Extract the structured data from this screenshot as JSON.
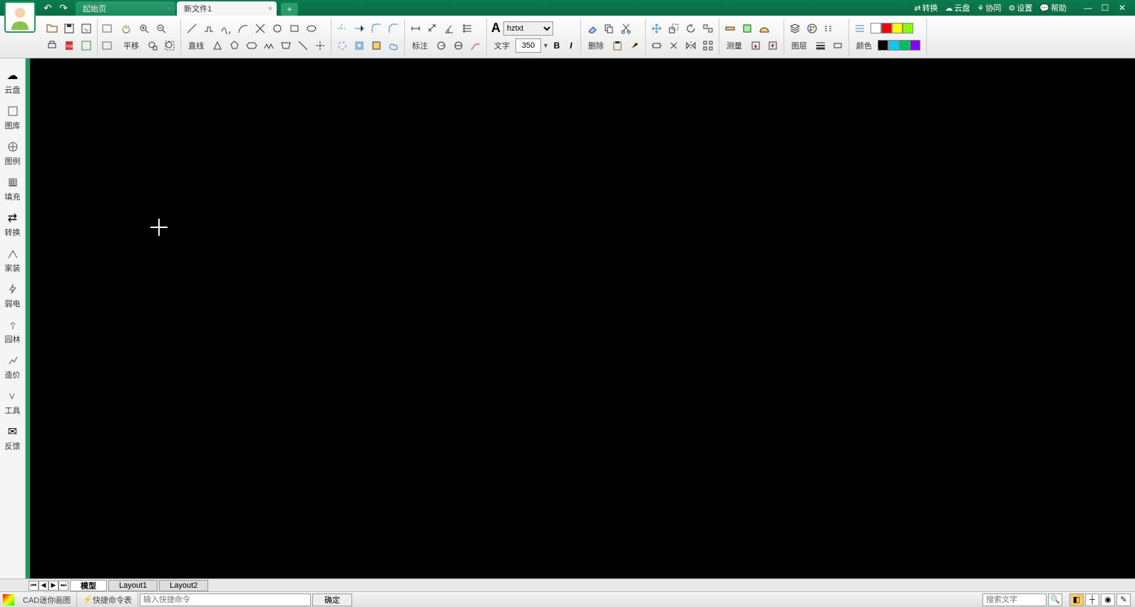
{
  "title_bar": {
    "tabs": [
      {
        "label": "起始页"
      },
      {
        "label": "新文件1"
      }
    ],
    "links": {
      "convert": "转换",
      "cloud": "云盘",
      "collab": "协同",
      "settings": "设置",
      "help": "帮助"
    }
  },
  "ribbon": {
    "pan": "平移",
    "line": "直线",
    "dim": "标注",
    "text": "文字",
    "font_name": "hztxt",
    "font_size": "350",
    "bold": "B",
    "italic": "I",
    "delete": "删除",
    "measure": "测量",
    "layer": "图层",
    "color": "颜色"
  },
  "sidebar": {
    "items": [
      {
        "label": "云盘"
      },
      {
        "label": "图库"
      },
      {
        "label": "图例"
      },
      {
        "label": "填充"
      },
      {
        "label": "转换"
      },
      {
        "label": "家装"
      },
      {
        "label": "弱电"
      },
      {
        "label": "园林"
      },
      {
        "label": "造价"
      },
      {
        "label": "工具"
      },
      {
        "label": "反馈"
      }
    ]
  },
  "layout_tabs": {
    "model": "模型",
    "layout1": "Layout1",
    "layout2": "Layout2"
  },
  "status": {
    "app_name": "CAD迷你画图",
    "shortcut": "快捷命令表",
    "cmd_placeholder": "输入快捷命令",
    "confirm": "确定",
    "search_placeholder": "搜索文字"
  },
  "colors": {
    "swatches": [
      "#ffffff",
      "#ff0000",
      "#ffff00",
      "#80ff00",
      "#000000",
      "#00c0ff",
      "#00ff80",
      "#8000ff"
    ]
  }
}
